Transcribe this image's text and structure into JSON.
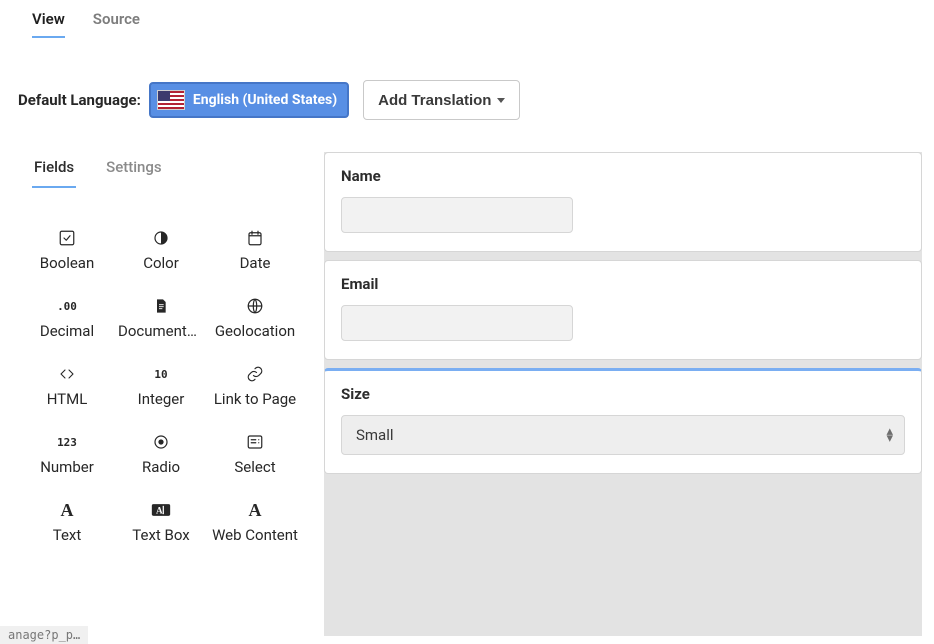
{
  "top_tabs": {
    "view": "View",
    "source": "Source"
  },
  "lang": {
    "label": "Default Language:",
    "chip": "English (United States)",
    "add": "Add Translation"
  },
  "sub_tabs": {
    "fields": "Fields",
    "settings": "Settings"
  },
  "field_types": [
    {
      "name": "boolean",
      "label": "Boolean",
      "glyph": "check-square"
    },
    {
      "name": "color",
      "label": "Color",
      "glyph": "contrast"
    },
    {
      "name": "date",
      "label": "Date",
      "glyph": "calendar"
    },
    {
      "name": "decimal",
      "label": "Decimal",
      "glyph": "decimal"
    },
    {
      "name": "document",
      "label": "Documents and Media",
      "glyph": "document"
    },
    {
      "name": "geolocation",
      "label": "Geolocation",
      "glyph": "globe"
    },
    {
      "name": "html",
      "label": "HTML",
      "glyph": "code"
    },
    {
      "name": "integer",
      "label": "Integer",
      "glyph": "integer"
    },
    {
      "name": "link",
      "label": "Link to Page",
      "glyph": "link"
    },
    {
      "name": "number",
      "label": "Number",
      "glyph": "number"
    },
    {
      "name": "radio",
      "label": "Radio",
      "glyph": "radio"
    },
    {
      "name": "select-field",
      "label": "Select",
      "glyph": "select"
    },
    {
      "name": "text",
      "label": "Text",
      "glyph": "text"
    },
    {
      "name": "textbox",
      "label": "Text Box",
      "glyph": "textbox"
    },
    {
      "name": "webcontent",
      "label": "Web Content",
      "glyph": "text"
    }
  ],
  "form": {
    "name": {
      "label": "Name",
      "value": ""
    },
    "email": {
      "label": "Email",
      "value": ""
    },
    "size": {
      "label": "Size",
      "value": "Small"
    }
  },
  "crumb": "anage?p_p…"
}
